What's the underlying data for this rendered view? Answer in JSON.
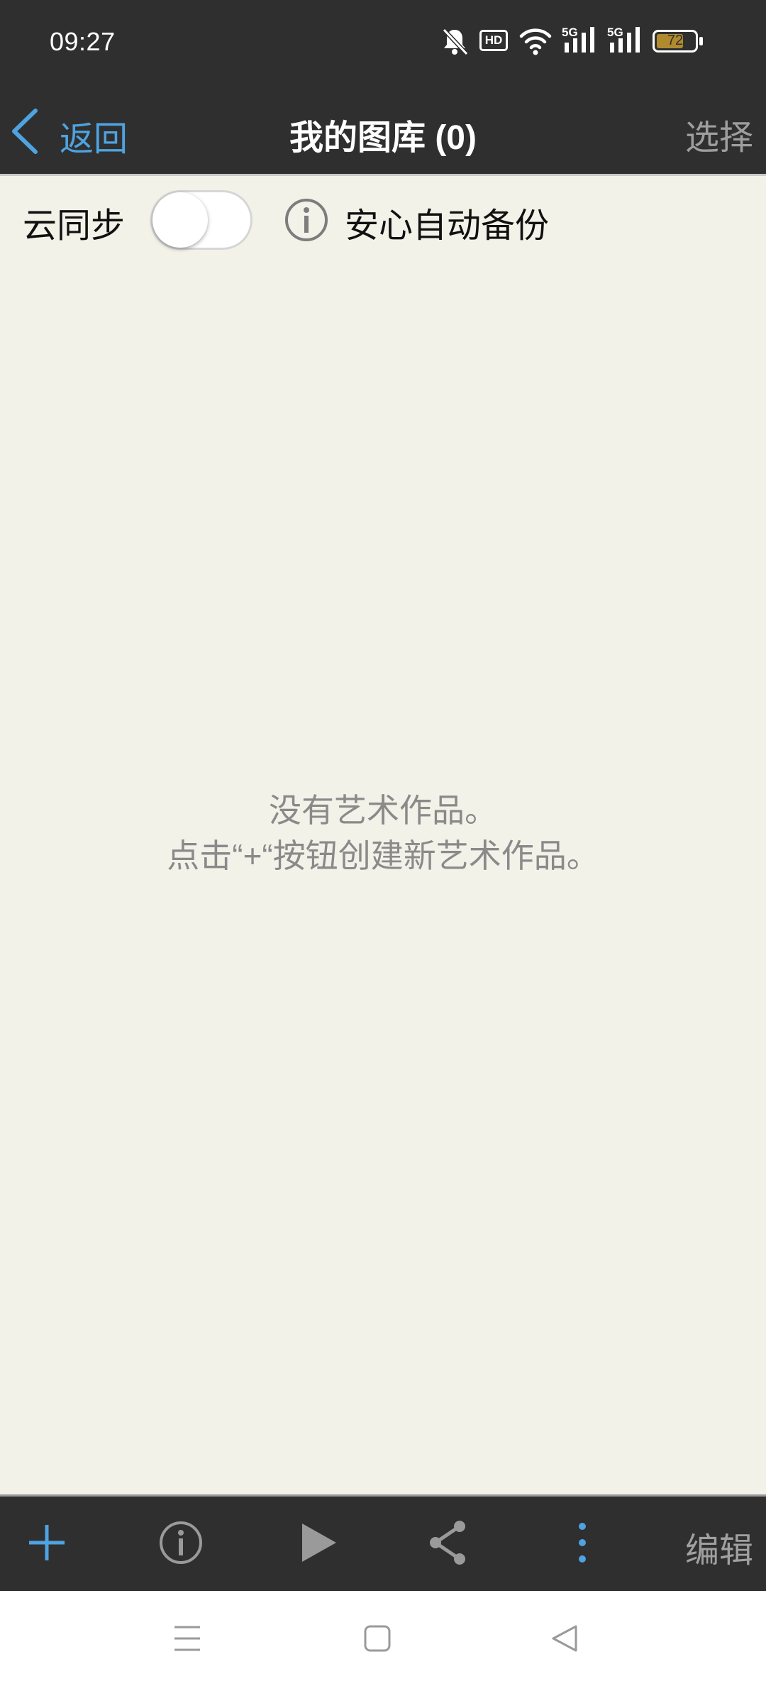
{
  "status_bar": {
    "time": "09:27",
    "icons": [
      "bell-muted-icon",
      "hd-icon",
      "wifi-icon",
      "signal-5g-icon",
      "signal-5g-icon",
      "battery-icon"
    ],
    "hd_text": "HD",
    "network_1": "5G",
    "network_2": "5G",
    "battery_level": "72",
    "battery_color": "#b08a2e"
  },
  "nav": {
    "back_label": "返回",
    "title": "我的图库 (0)",
    "select_label": "选择"
  },
  "sync_row": {
    "label": "云同步",
    "toggle_on": false,
    "backup_label": "安心自动备份"
  },
  "empty_state": {
    "line1": "没有艺术作品。",
    "line2": "点击“+“按钮创建新艺术作品。"
  },
  "toolbar": {
    "items": [
      "plus-icon",
      "info-icon",
      "play-icon",
      "share-icon",
      "more-vertical-icon"
    ],
    "edit_label": "编辑"
  },
  "system_nav": {
    "items": [
      "menu-icon",
      "home-icon",
      "back-triangle-icon"
    ]
  },
  "colors": {
    "bar_background": "#2f2f2f",
    "content_background": "#f3f2e9",
    "accent_blue": "#4ea3e0",
    "muted_gray": "#9e9e9e"
  }
}
